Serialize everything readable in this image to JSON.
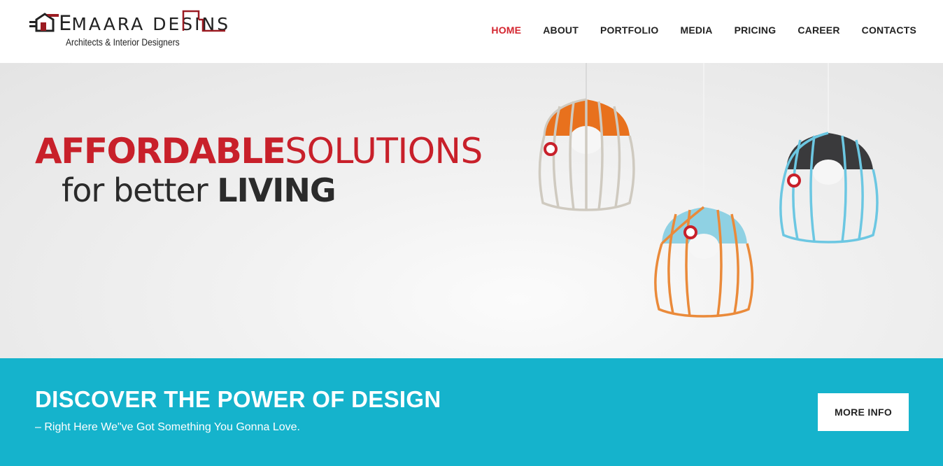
{
  "header": {
    "logo": {
      "title_first": "E",
      "title_rest": "MAARA DESI",
      "title_end": "NS",
      "tagline": "Architects & Interior Designers"
    },
    "nav": [
      {
        "label": "HOME",
        "active": true
      },
      {
        "label": "ABOUT",
        "active": false
      },
      {
        "label": "PORTFOLIO",
        "active": false
      },
      {
        "label": "MEDIA",
        "active": false
      },
      {
        "label": "PRICING",
        "active": false
      },
      {
        "label": "CAREER",
        "active": false
      },
      {
        "label": "CONTACTS",
        "active": false
      }
    ]
  },
  "hero": {
    "line1_bold": "AFFORDABLE",
    "line1_light": "SOLUTIONS",
    "line2_light": "for better ",
    "line2_bold": "LIVING",
    "image_icons": [
      "lamp-orange-white",
      "lamp-blue-orange",
      "lamp-dark-blue"
    ]
  },
  "banner": {
    "title": "DISCOVER THE POWER OF DESIGN",
    "subtitle": "– Right Here We\"ve Got Something You Gonna Love.",
    "button_label": "MORE INFO"
  },
  "colors": {
    "accent_red": "#c8202a",
    "nav_active": "#d4252f",
    "banner_bg": "#15b3cc",
    "text_dark": "#222222"
  }
}
